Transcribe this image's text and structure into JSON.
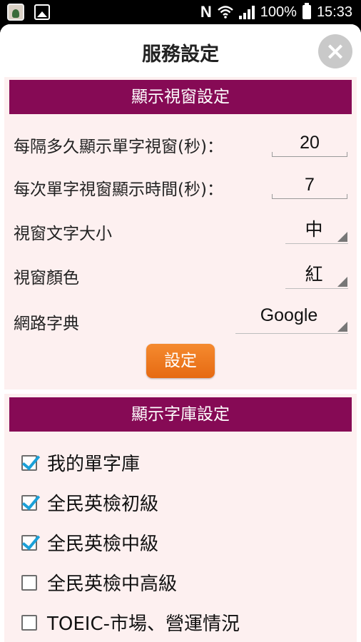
{
  "status_bar": {
    "nfc": "N",
    "battery_text": "100%",
    "time": "15:33"
  },
  "dialog": {
    "title": "服務設定",
    "close_icon": "×"
  },
  "display_window": {
    "header": "顯示視窗設定",
    "interval_label": "每隔多久顯示單字視窗(秒)：",
    "interval_value": "20",
    "duration_label": "每次單字視窗顯示時間(秒)：",
    "duration_value": "7",
    "font_size_label": "視窗文字大小",
    "font_size_value": "中",
    "color_label": "視窗顏色",
    "color_value": "紅",
    "dictionary_label": "網路字典",
    "dictionary_value": "Google",
    "set_button": "設定"
  },
  "word_library": {
    "header": "顯示字庫設定",
    "items": [
      {
        "label": "我的單字庫",
        "checked": true
      },
      {
        "label": "全民英檢初級",
        "checked": true
      },
      {
        "label": "全民英檢中級",
        "checked": true
      },
      {
        "label": "全民英檢中高級",
        "checked": false
      },
      {
        "label": "TOEIC-市場、營運情況",
        "checked": false
      }
    ]
  },
  "colors": {
    "section_header": "#860a55",
    "section_bg": "#fdf0f0",
    "button_orange": "#f07a20",
    "checkbox_check": "#1aa0d8"
  }
}
